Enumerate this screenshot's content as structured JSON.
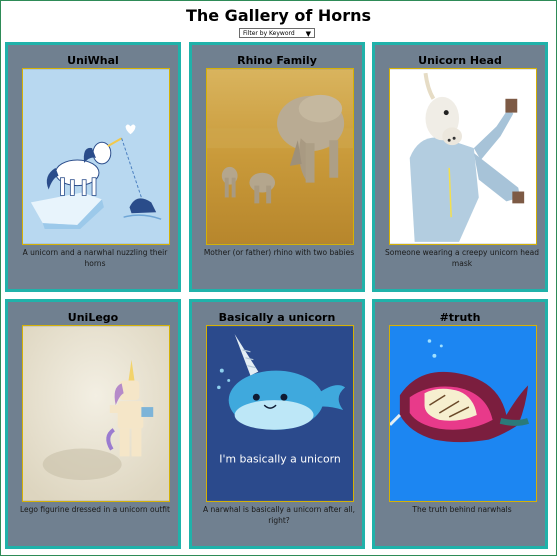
{
  "page": {
    "title": "The Gallery of Horns"
  },
  "filter": {
    "label": "Filter by Keyword",
    "arrow": "▼"
  },
  "cards": [
    {
      "title": "UniWhal",
      "caption": "A unicorn and a narwhal nuzzling their horns"
    },
    {
      "title": "Rhino Family",
      "caption": "Mother (or father) rhino with two babies"
    },
    {
      "title": "Unicorn Head",
      "caption": "Someone wearing a creepy unicorn head mask"
    },
    {
      "title": "UniLego",
      "caption": "Lego figurine dressed in a unicorn outfit"
    },
    {
      "title": "Basically a unicorn",
      "caption": "A narwhal is basically a unicorn after all, right?",
      "image_text": "I'm basically a unicorn"
    },
    {
      "title": "#truth",
      "caption": "The truth behind narwhals"
    }
  ]
}
